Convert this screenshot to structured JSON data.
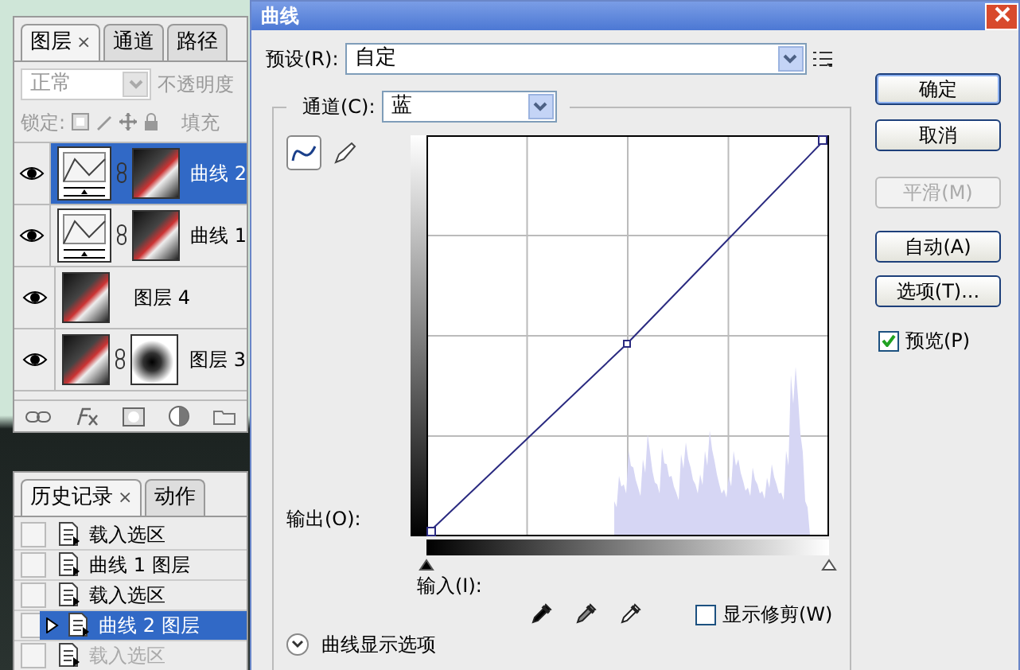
{
  "layers_panel": {
    "tabs": [
      {
        "label": "图层",
        "close": "×",
        "selected": true
      },
      {
        "label": "通道",
        "selected": false
      },
      {
        "label": "路径",
        "selected": false
      }
    ],
    "blend_mode": "正常",
    "opacity_label": "不透明度",
    "lock_label": "锁定:",
    "fill_label": "填充",
    "layers": [
      {
        "name": "曲线 2",
        "kind": "adjustment",
        "visible": true,
        "selected": true
      },
      {
        "name": "曲线 1",
        "kind": "adjustment",
        "visible": true,
        "selected": false
      },
      {
        "name": "图层 4",
        "kind": "pixel",
        "visible": true,
        "selected": false
      },
      {
        "name": "图层 3",
        "kind": "masked",
        "visible": true,
        "selected": false
      }
    ]
  },
  "history_panel": {
    "tabs": [
      {
        "label": "历史记录",
        "close": "×",
        "selected": true
      },
      {
        "label": "动作",
        "selected": false
      }
    ],
    "items": [
      {
        "label": "载入选区",
        "selected": false,
        "undone": false
      },
      {
        "label": "曲线 1 图层",
        "selected": false,
        "undone": false
      },
      {
        "label": "载入选区",
        "selected": false,
        "undone": false
      },
      {
        "label": "曲线 2 图层",
        "selected": true,
        "undone": false
      },
      {
        "label": "载入选区",
        "selected": false,
        "undone": true
      }
    ]
  },
  "curves_dialog": {
    "title": "曲线",
    "preset_label": "预设(R):",
    "preset": "自定",
    "channel_label": "通道(C):",
    "channel": "蓝",
    "tools": [
      {
        "kind": "curve",
        "selected": true
      },
      {
        "kind": "pencil",
        "selected": false
      }
    ],
    "output_label": "输出(O):",
    "input_label": "输入(I):",
    "input_sliders": [
      {
        "level": 0
      },
      {
        "level": 1
      }
    ],
    "show_clipping": {
      "label": "显示修剪(W)",
      "checked": false
    },
    "display_options": "曲线显示选项",
    "buttons": [
      {
        "label": "确定",
        "default": true,
        "disabled": false
      },
      {
        "label": "取消",
        "default": false,
        "disabled": false
      },
      {
        "label": "平滑(M)",
        "default": false,
        "disabled": true
      },
      {
        "label": "自动(A)",
        "default": false,
        "disabled": false
      },
      {
        "label": "选项(T)...",
        "default": false,
        "disabled": false
      }
    ],
    "preview": {
      "label": "预览(P)",
      "checked": true
    }
  }
}
